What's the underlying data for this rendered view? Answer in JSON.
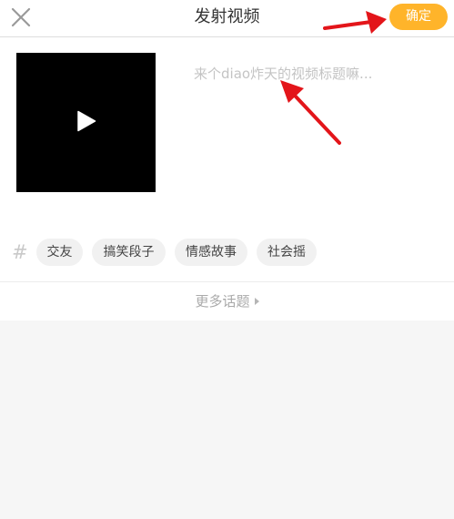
{
  "header": {
    "title": "发射视频",
    "confirm_label": "确定",
    "close_icon": "close-icon"
  },
  "video": {
    "play_icon": "play-icon",
    "title_placeholder": "来个diao炸天的视频标题嘛..."
  },
  "topics": {
    "hash_symbol": "#",
    "chips": [
      "交友",
      "搞笑段子",
      "情感故事",
      "社会摇"
    ],
    "more_label": "更多话题"
  },
  "colors": {
    "accent": "#ffb42a",
    "annotation_arrow": "#e3151a"
  }
}
